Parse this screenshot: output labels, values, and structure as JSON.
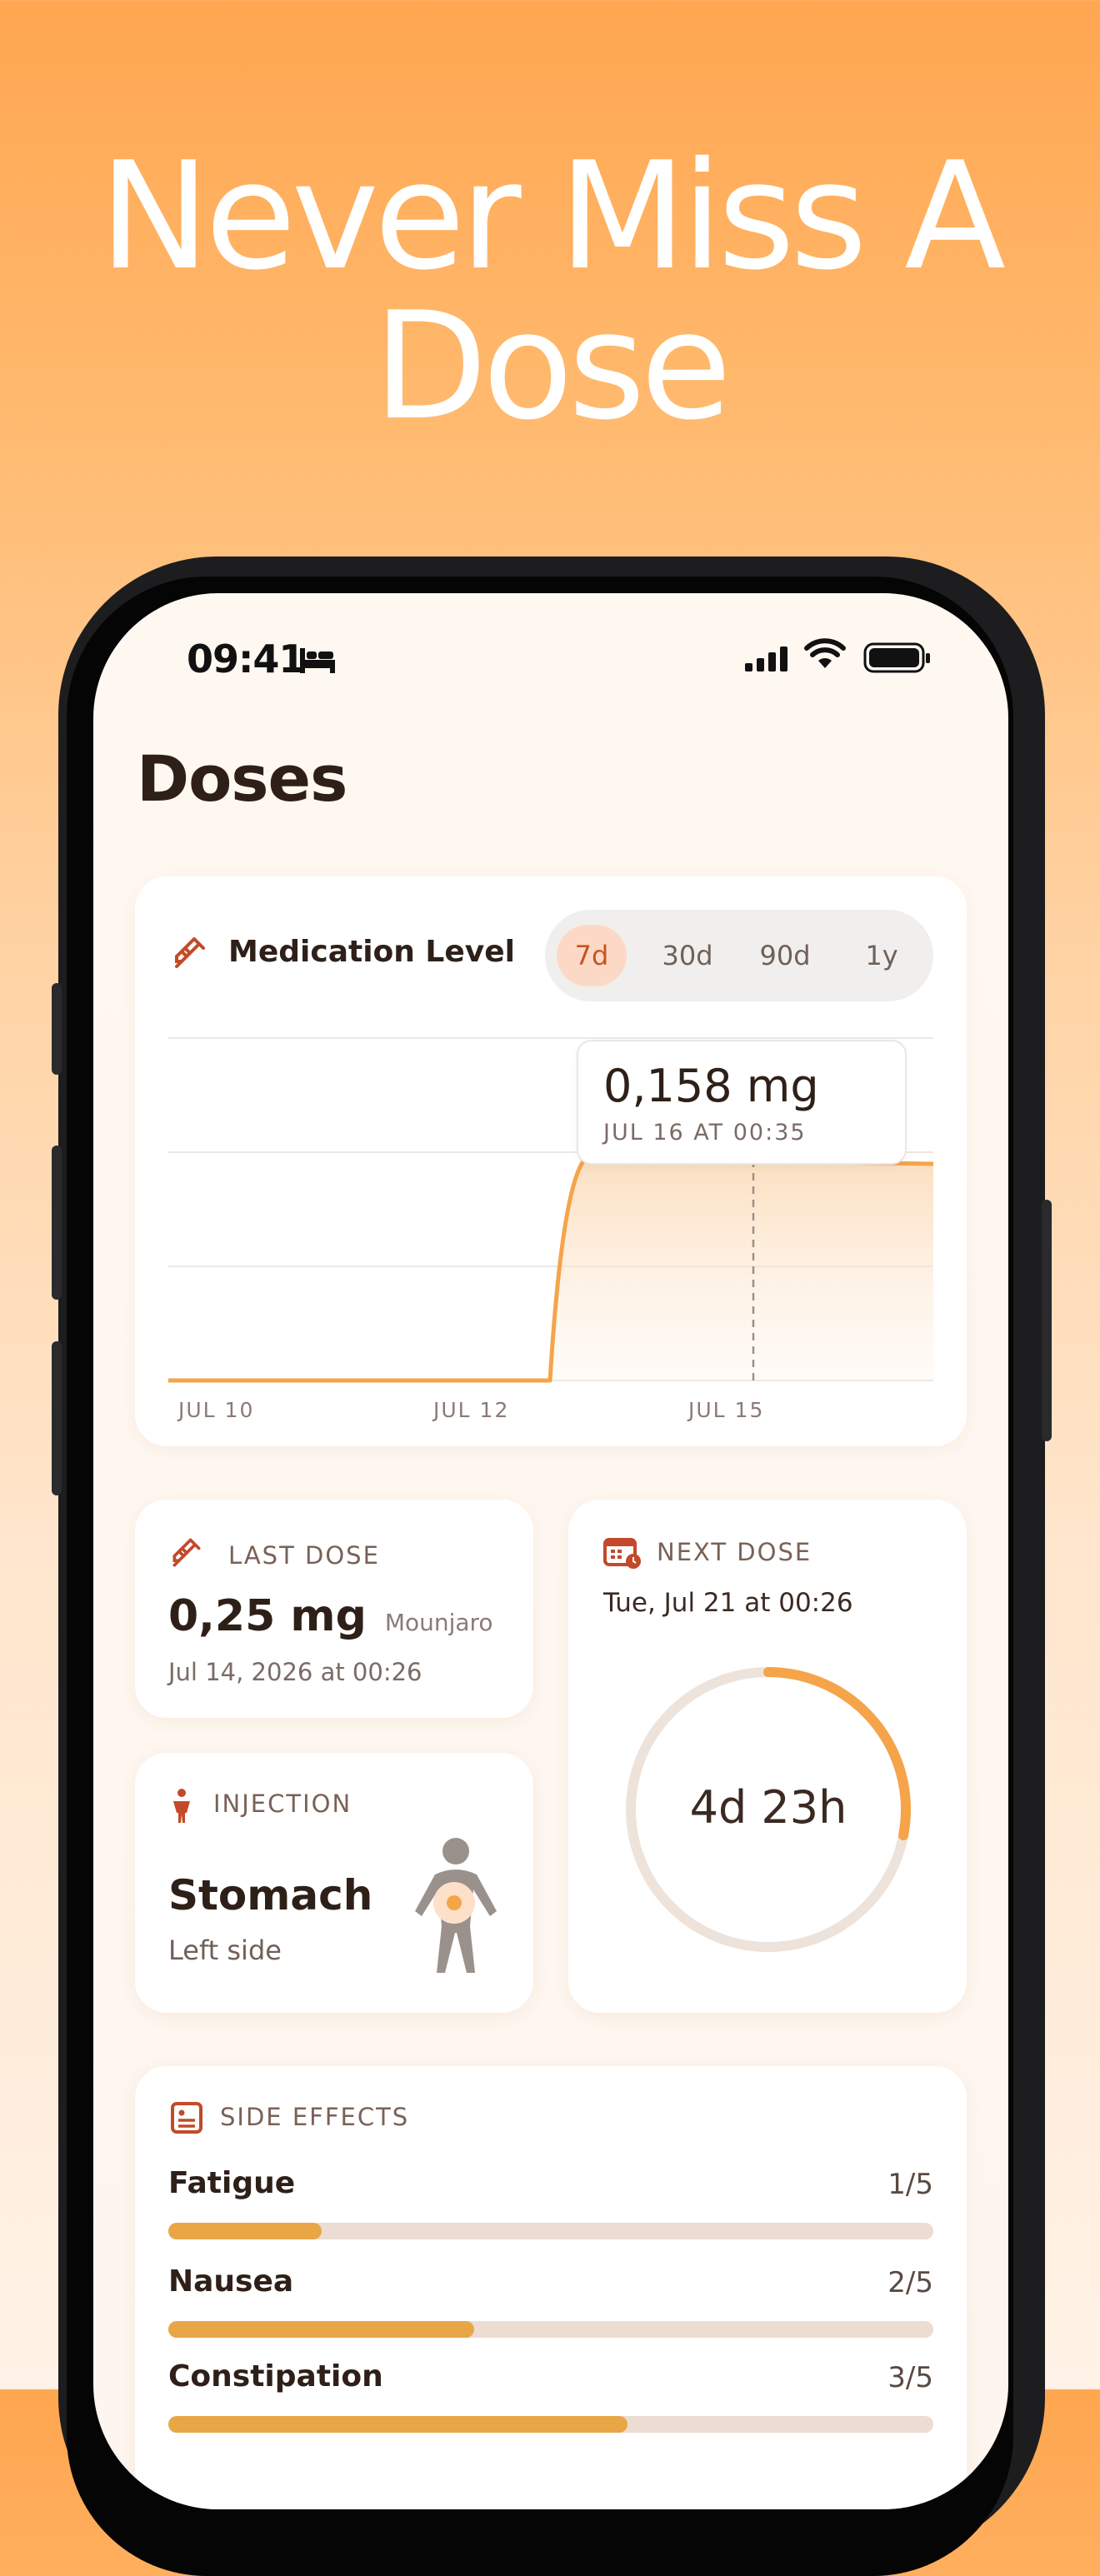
{
  "headline": "Never Miss A Dose",
  "status_bar": {
    "time": "09:41"
  },
  "page_title": "Doses",
  "medication_level": {
    "title": "Medication Level",
    "ranges": [
      "7d",
      "30d",
      "90d",
      "1y"
    ],
    "selected_range": "7d",
    "tooltip": {
      "value": "0,158 mg",
      "date": "JUL 16 AT 00:35"
    }
  },
  "chart_data": {
    "type": "area",
    "x_ticks": [
      "JUL 10",
      "JUL 12",
      "JUL 15"
    ],
    "x": [
      "Jul 9",
      "Jul 10",
      "Jul 11",
      "Jul 12",
      "Jul 13",
      "Jul 14 00:26",
      "Jul 14 06:00",
      "Jul 15",
      "Jul 16 00:35",
      "Jul 16 12:00"
    ],
    "series": [
      {
        "values": [
          0,
          0,
          0,
          0,
          0,
          0,
          0.158,
          0.159,
          0.158,
          0.156
        ]
      }
    ],
    "selected_point": {
      "x": "Jul 16 00:35",
      "y": 0.158
    },
    "grid": true,
    "line_color": "#f5a44a"
  },
  "last_dose": {
    "label": "LAST DOSE",
    "amount": "0,25 mg",
    "medication": "Mounjaro",
    "date": "Jul 14, 2026 at 00:26"
  },
  "next_dose": {
    "label": "NEXT DOSE",
    "date": "Tue, Jul 21 at 00:26",
    "countdown": "4d 23h",
    "elapsed_fraction": 0.28
  },
  "injection": {
    "label": "INJECTION",
    "site": "Stomach",
    "side": "Left side"
  },
  "side_effects": {
    "label": "SIDE EFFECTS",
    "items": [
      {
        "name": "Fatigue",
        "value": "1/5",
        "level": 0.2
      },
      {
        "name": "Nausea",
        "value": "2/5",
        "level": 0.4
      },
      {
        "name": "Constipation",
        "value": "3/5",
        "level": 0.6
      }
    ]
  },
  "colors": {
    "accent": "#f5a44a",
    "accent_text": "#c9531f",
    "icon": "#c24a2a"
  }
}
